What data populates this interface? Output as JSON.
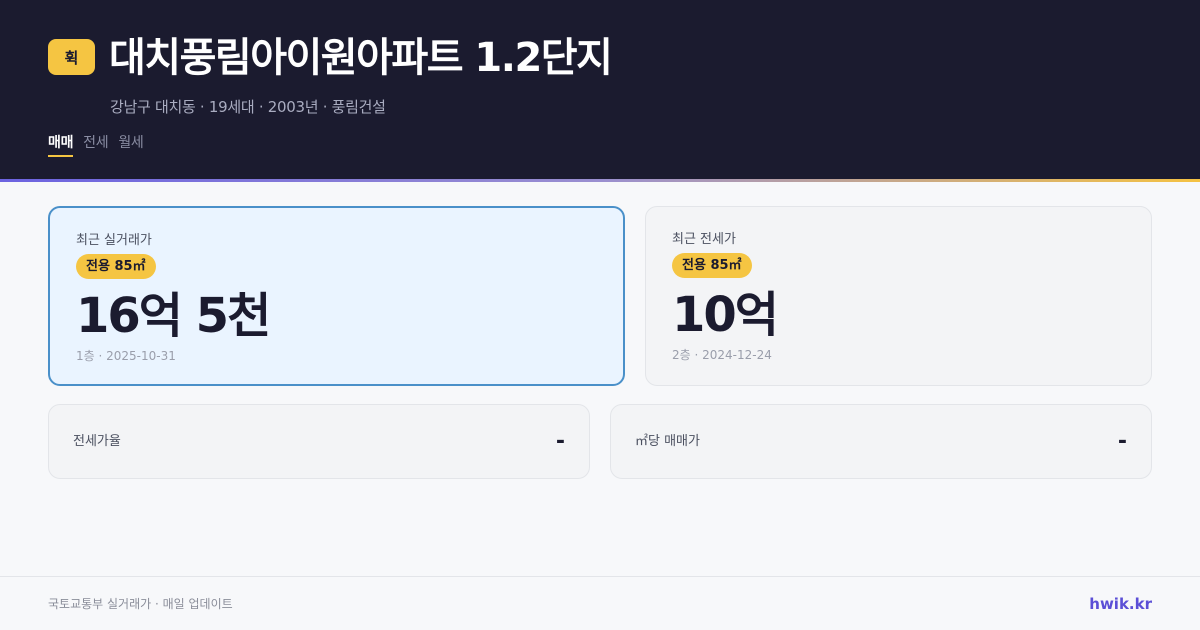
{
  "header": {
    "logo": "휙",
    "title": "대치풍림아이원아파트 1.2단지",
    "subtitle": "강남구 대치동 · 19세대 · 2003년 · 풍림건설",
    "tabs": [
      {
        "label": "매매",
        "active": true
      },
      {
        "label": "전세",
        "active": false
      },
      {
        "label": "월세",
        "active": false
      }
    ]
  },
  "cards": {
    "sale": {
      "label": "최근 실거래가",
      "area": "전용 85㎡",
      "price": "16억 5천",
      "meta": "1층 · 2025-10-31"
    },
    "rent": {
      "label": "최근 전세가",
      "area": "전용 85㎡",
      "price": "10억",
      "meta": "2층 · 2024-12-24"
    }
  },
  "stats": {
    "jeonse_ratio": {
      "label": "전세가율",
      "value": "-"
    },
    "price_per_m2": {
      "label": "㎡당 매매가",
      "value": "-"
    }
  },
  "footer": {
    "source": "국토교통부 실거래가 · 매일 업데이트",
    "brand": "hwik.kr"
  },
  "colors": {
    "header_bg": "#1b1b2f",
    "accent_yellow": "#f5c542",
    "accent_blue": "#4a90c9",
    "brand_purple": "#5b4fd6"
  }
}
